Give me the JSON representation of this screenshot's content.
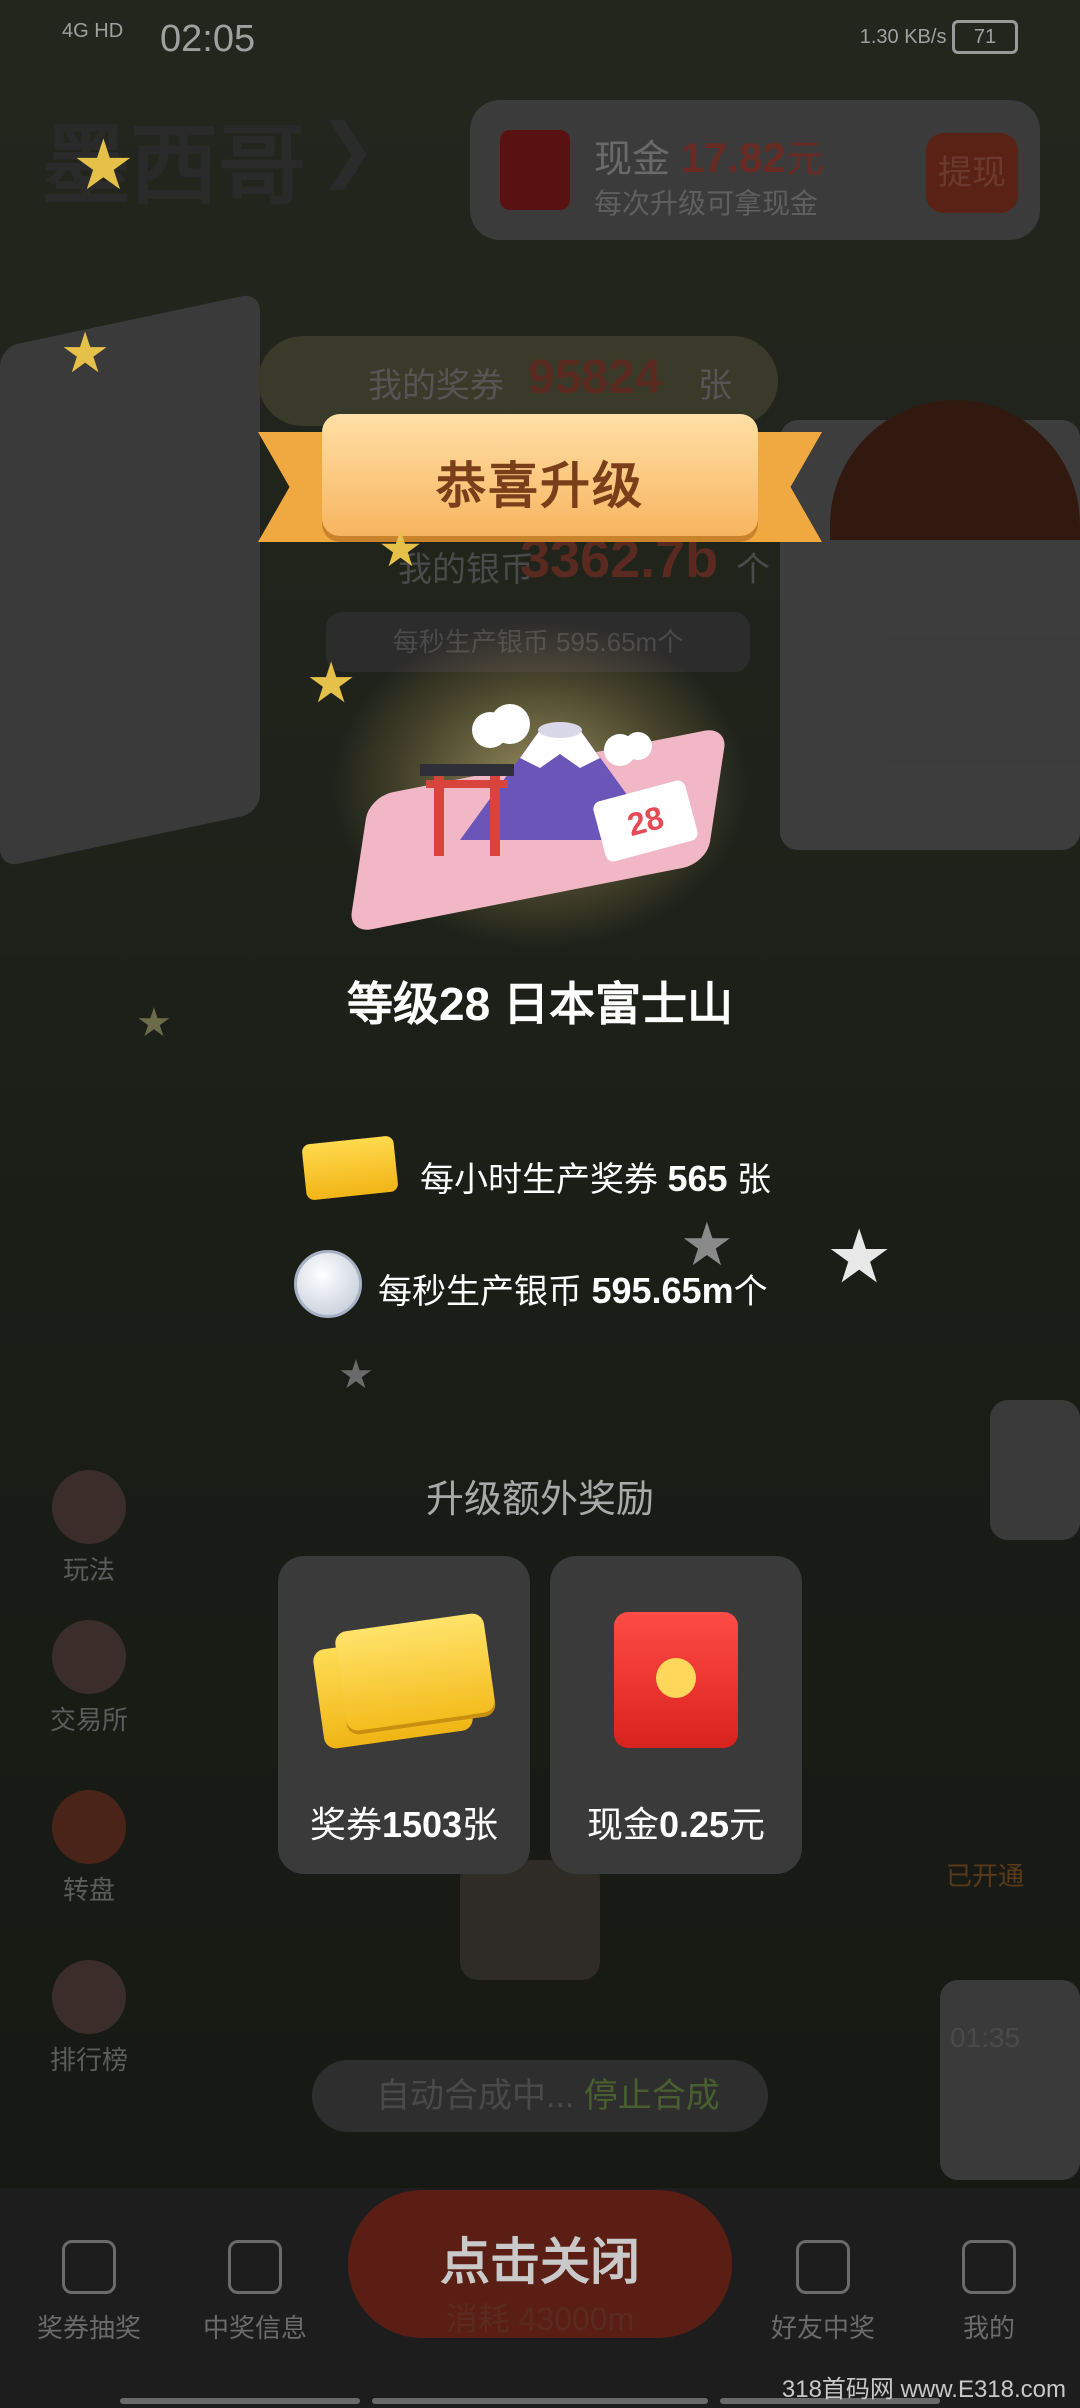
{
  "status_bar": {
    "network": "4G",
    "hd": "HD",
    "time": "02:05",
    "speed": "1.30 KB/s",
    "battery": "71"
  },
  "top": {
    "name": "墨西哥",
    "cash_label": "现金",
    "cash_value": "17.82",
    "cash_unit": "元",
    "cash_sub": "每次升级可拿现金",
    "withdraw_button": "提现",
    "tickets_label": "我的奖券",
    "tickets_value": "95824",
    "tickets_unit": "张",
    "silver_label": "我的银币",
    "silver_value": "3362.7b",
    "silver_unit": "个",
    "silver_rate": "每秒生产银币 595.65m个"
  },
  "modal": {
    "ribbon_title": "恭喜升级",
    "building_badge": "28",
    "level_title": "等级28 日本富士山",
    "hourly_prefix": "每小时生产奖券",
    "hourly_value": "565",
    "hourly_unit": "张",
    "per_sec_prefix": "每秒生产银币",
    "per_sec_value": "595.65m",
    "per_sec_unit": "个",
    "extra_title": "升级额外奖励",
    "reward_tickets_label": "奖券",
    "reward_tickets_value": "1503",
    "reward_tickets_unit": "张",
    "reward_cash_label": "现金",
    "reward_cash_value": "0.25",
    "reward_cash_unit": "元",
    "close_button": "点击关闭"
  },
  "side_left": [
    "玩法",
    "交易所",
    "转盘",
    "排行榜"
  ],
  "side_right": {
    "open_label": "已开通",
    "timer": "01:35"
  },
  "auto_merge": {
    "label": "自动合成中...",
    "stop": "停止合成"
  },
  "bottom_nav": {
    "items": [
      "奖券抽奖",
      "中奖信息",
      "好友中奖",
      "我的"
    ],
    "center_cost": "消耗 43000m"
  },
  "watermark": "318首码网 www.E318.com",
  "colors": {
    "accent_red": "#e5403a",
    "gold": "#f2b516",
    "ribbon": "#f7b560"
  }
}
